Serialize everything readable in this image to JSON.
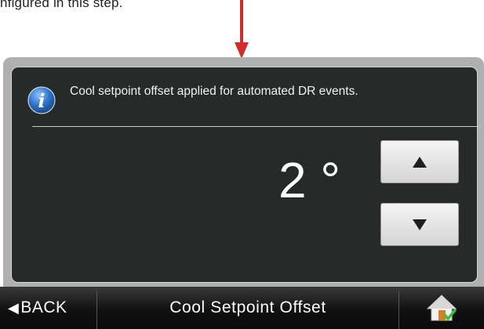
{
  "caption": "nfigured in this step.",
  "message": "Cool setpoint offset applied for automated DR events.",
  "setpoint": {
    "value": "2 °"
  },
  "buttons": {
    "up": "▲",
    "down": "▼"
  },
  "bottom_bar": {
    "back_arrow": "◀",
    "back_label": "BACK",
    "title": "Cool Setpoint Offset"
  },
  "icons": [
    "down-arrow-indicator",
    "info-icon",
    "up-arrow-icon",
    "down-arrow-icon",
    "back-arrow-icon",
    "home-icon"
  ],
  "colors": {
    "screen_bg": "#262a28",
    "indicator_arrow": "#d32a2a",
    "info_icon": "#2f76c9"
  }
}
